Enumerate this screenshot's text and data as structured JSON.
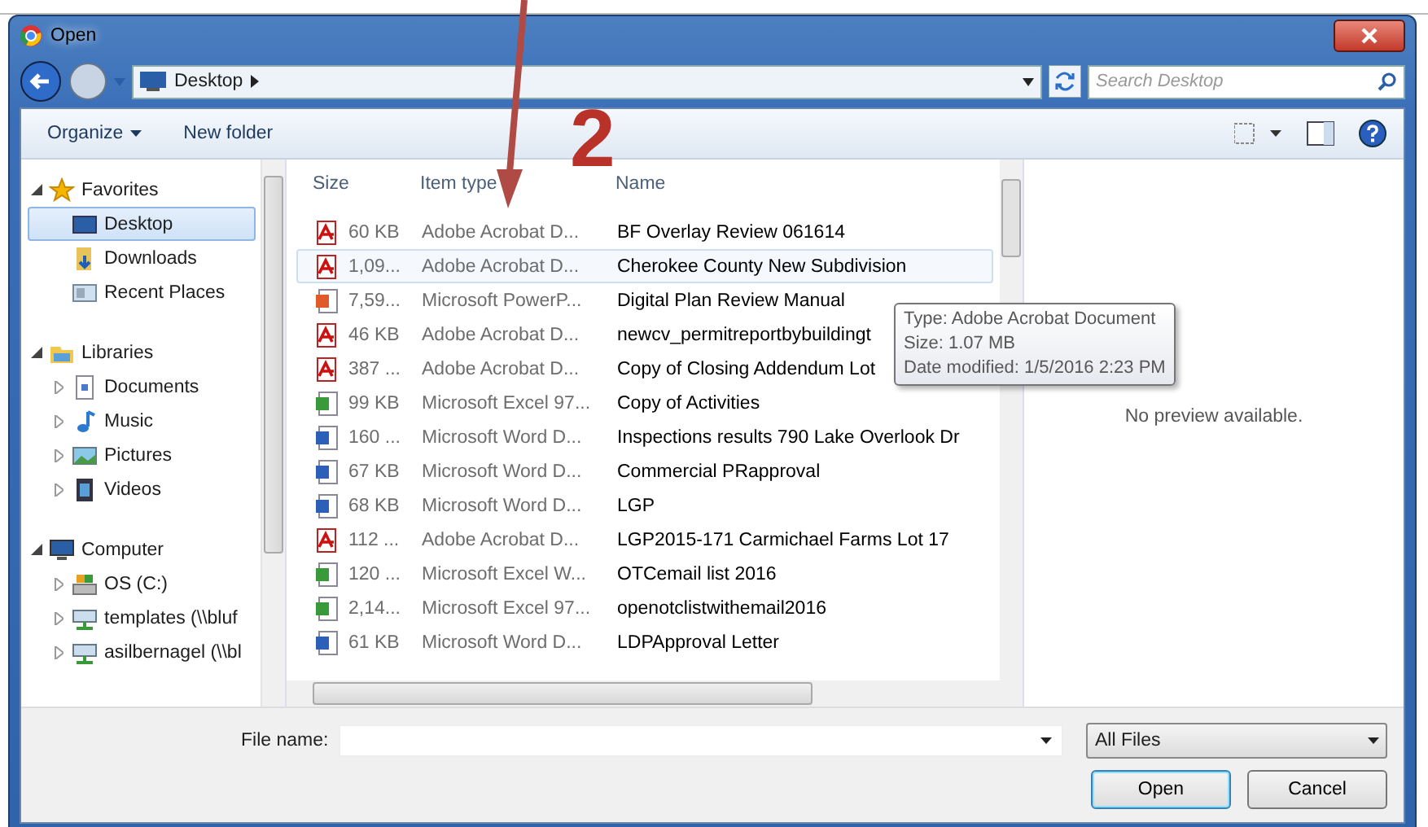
{
  "window": {
    "title": "Open"
  },
  "address": {
    "location": "Desktop"
  },
  "search": {
    "placeholder": "Search Desktop"
  },
  "toolbar": {
    "buttons": [
      "Organize",
      "New folder"
    ]
  },
  "sidebar": {
    "groups": [
      {
        "label": "Favorites",
        "kind": "star",
        "expanded": true,
        "items": [
          {
            "label": "Desktop",
            "kind": "desktop",
            "has_children": false,
            "selected": true
          },
          {
            "label": "Downloads",
            "kind": "downloads",
            "has_children": false,
            "selected": false
          },
          {
            "label": "Recent Places",
            "kind": "recent",
            "has_children": false,
            "selected": false
          }
        ]
      },
      {
        "label": "Libraries",
        "kind": "library",
        "expanded": true,
        "items": [
          {
            "label": "Documents",
            "kind": "documents",
            "has_children": true,
            "selected": false
          },
          {
            "label": "Music",
            "kind": "music",
            "has_children": true,
            "selected": false
          },
          {
            "label": "Pictures",
            "kind": "pictures",
            "has_children": true,
            "selected": false
          },
          {
            "label": "Videos",
            "kind": "videos",
            "has_children": true,
            "selected": false
          }
        ]
      },
      {
        "label": "Computer",
        "kind": "computer",
        "expanded": true,
        "items": [
          {
            "label": "OS (C:)",
            "kind": "drive",
            "has_children": true,
            "selected": false
          },
          {
            "label": "templates (\\\\bluf",
            "kind": "network",
            "has_children": true,
            "selected": false
          },
          {
            "label": "asilbernagel (\\\\bl",
            "kind": "network",
            "has_children": true,
            "selected": false
          }
        ]
      }
    ]
  },
  "table": {
    "columns": [
      "Size",
      "Item type",
      "Name"
    ],
    "rows": [
      {
        "kind": "pdf",
        "size": "60 KB",
        "type": "Adobe Acrobat D...",
        "name": "BF Overlay Review 061614",
        "selected": false
      },
      {
        "kind": "pdf",
        "size": "1,09...",
        "type": "Adobe Acrobat D...",
        "name": "Cherokee County New Subdivision",
        "selected": true
      },
      {
        "kind": "ppt",
        "size": "7,59...",
        "type": "Microsoft PowerP...",
        "name": "Digital Plan Review Manual",
        "selected": false
      },
      {
        "kind": "pdf",
        "size": "46 KB",
        "type": "Adobe Acrobat D...",
        "name": "newcv_permitreportbybuildingt",
        "selected": false
      },
      {
        "kind": "pdf",
        "size": "387 ...",
        "type": "Adobe Acrobat D...",
        "name": "Copy of Closing Addendum Lot",
        "selected": false
      },
      {
        "kind": "xls",
        "size": "99 KB",
        "type": "Microsoft Excel 97...",
        "name": "Copy of Activities",
        "selected": false
      },
      {
        "kind": "doc",
        "size": "160 ...",
        "type": "Microsoft Word D...",
        "name": "Inspections results 790 Lake Overlook Dr",
        "selected": false
      },
      {
        "kind": "doc",
        "size": "67 KB",
        "type": "Microsoft Word D...",
        "name": "Commercial PRapproval",
        "selected": false
      },
      {
        "kind": "doc",
        "size": "68 KB",
        "type": "Microsoft Word D...",
        "name": "LGP",
        "selected": false
      },
      {
        "kind": "pdf",
        "size": "112 ...",
        "type": "Adobe Acrobat D...",
        "name": "LGP2015-171 Carmichael Farms Lot 17",
        "selected": false
      },
      {
        "kind": "xls",
        "size": "120 ...",
        "type": "Microsoft Excel W...",
        "name": "OTCemail list 2016",
        "selected": false
      },
      {
        "kind": "xls",
        "size": "2,14...",
        "type": "Microsoft Excel 97...",
        "name": "openotclistwithemail2016",
        "selected": false
      },
      {
        "kind": "doc",
        "size": "61 KB",
        "type": "Microsoft Word D...",
        "name": "LDPApproval Letter",
        "selected": false
      }
    ]
  },
  "tooltip": {
    "lines": [
      "Type: Adobe Acrobat Document",
      "Size: 1.07 MB",
      "Date modified: 1/5/2016 2:23 PM"
    ]
  },
  "preview": {
    "message": "No preview available."
  },
  "footer": {
    "file_name_label": "File name:",
    "filter": "All Files",
    "buttons": [
      "Open",
      "Cancel"
    ]
  },
  "annotation": {
    "label": "2"
  }
}
